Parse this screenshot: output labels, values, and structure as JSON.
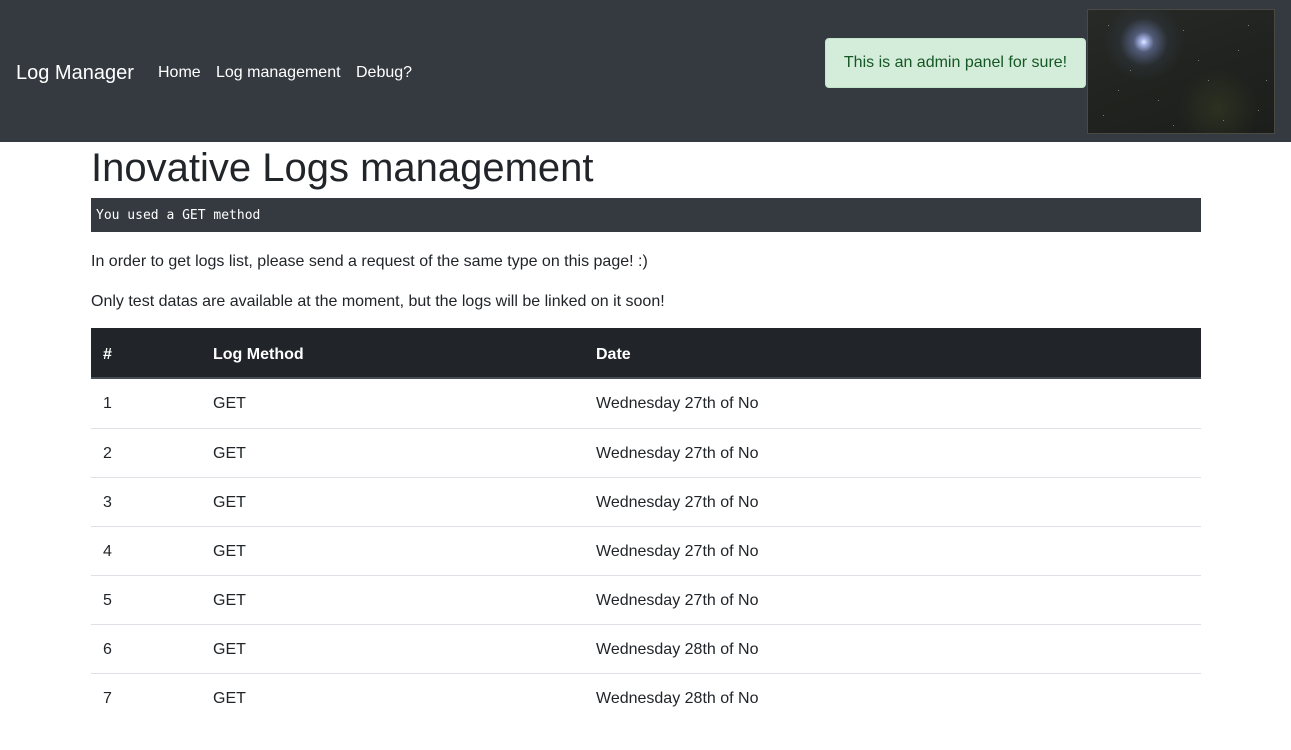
{
  "navbar": {
    "brand": "Log Manager",
    "links": [
      "Home",
      "Log management",
      "Debug?"
    ]
  },
  "alert": {
    "text": "This is an admin panel for sure!"
  },
  "image": {
    "description_icon": "space-image"
  },
  "main": {
    "title": "Inovative Logs management",
    "code": "You used a GET method",
    "paragraphs": [
      "In order to get logs list, please send a request of the same type on this page! :)",
      "Only test datas are available at the moment, but the logs will be linked on it soon!"
    ]
  },
  "table": {
    "headers": [
      "#",
      "Log Method",
      "Date"
    ],
    "rows": [
      [
        "1",
        "GET",
        "Wednesday 27th of No"
      ],
      [
        "2",
        "GET",
        "Wednesday 27th of No"
      ],
      [
        "3",
        "GET",
        "Wednesday 27th of No"
      ],
      [
        "4",
        "GET",
        "Wednesday 27th of No"
      ],
      [
        "5",
        "GET",
        "Wednesday 27th of No"
      ],
      [
        "6",
        "GET",
        "Wednesday 28th of No"
      ],
      [
        "7",
        "GET",
        "Wednesday 28th of No"
      ]
    ]
  },
  "colors": {
    "navbar_bg": "#343a40",
    "alert_bg": "#d4edda",
    "alert_text": "#155724",
    "table_head_bg": "#212529"
  }
}
